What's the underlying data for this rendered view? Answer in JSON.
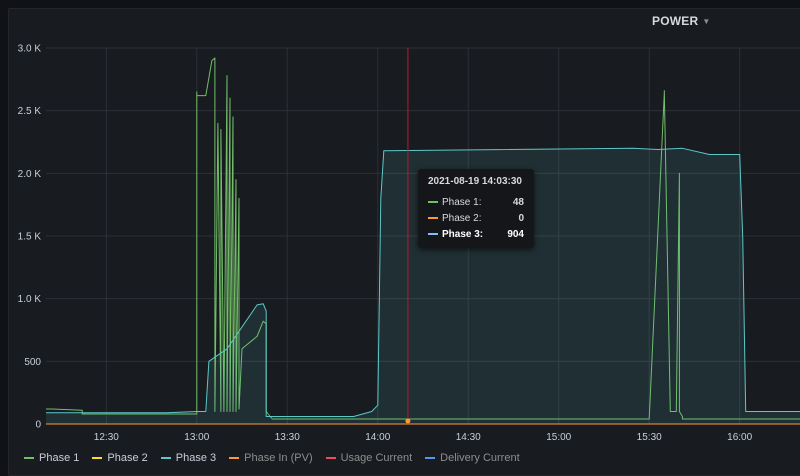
{
  "panel": {
    "title": "POWER"
  },
  "tooltip": {
    "time": "2021-08-19 14:03:30",
    "rows": [
      {
        "name": "Phase 1:",
        "value": "48",
        "color": "#73bf69"
      },
      {
        "name": "Phase 2:",
        "value": "0",
        "color": "#ff9830"
      },
      {
        "name": "Phase 3:",
        "value": "904",
        "color": "#8ab8ff"
      }
    ]
  },
  "legend": [
    {
      "name": "Phase 1",
      "color": "#73bf69"
    },
    {
      "name": "Phase 2",
      "color": "#fade2a"
    },
    {
      "name": "Phase 3",
      "color": "#5cc8c8"
    },
    {
      "name": "Phase In (PV)",
      "color": "#ff9830"
    },
    {
      "name": "Usage Current",
      "color": "#f2495c"
    },
    {
      "name": "Delivery Current",
      "color": "#5794f2"
    }
  ],
  "chart_data": {
    "type": "line",
    "x_range": [
      "12:10",
      "16:20"
    ],
    "x_ticks": [
      "12:30",
      "13:00",
      "13:30",
      "14:00",
      "14:30",
      "15:00",
      "15:30",
      "16:00"
    ],
    "y_range": [
      0,
      3000
    ],
    "y_ticks": [
      "0",
      "500",
      "1.0 K",
      "1.5 K",
      "2.0 K",
      "2.5 K",
      "3.0 K"
    ],
    "y_tick_values": [
      0,
      500,
      1000,
      1500,
      2000,
      2500,
      3000
    ],
    "crosshair_time": "14:10",
    "grid": true,
    "legend_position": "bottom-left",
    "series": [
      {
        "name": "Phase 1",
        "color": "#73bf69",
        "x": [
          "12:10",
          "12:12",
          "12:22",
          "12:22",
          "12:50",
          "13:00",
          "13:00",
          "13:00",
          "13:03",
          "13:05",
          "13:06",
          "13:06",
          "13:07",
          "13:08",
          "13:08",
          "13:09",
          "13:10",
          "13:10",
          "13:11",
          "13:11",
          "13:12",
          "13:12",
          "13:13",
          "13:13",
          "13:14",
          "13:14",
          "13:15",
          "13:20",
          "13:22",
          "13:23",
          "13:23",
          "13:25",
          "14:00",
          "15:00",
          "15:30",
          "15:35",
          "15:35",
          "15:37",
          "15:39",
          "15:40",
          "15:40",
          "15:40",
          "15:41",
          "15:41",
          "16:20"
        ],
        "y": [
          120,
          120,
          110,
          80,
          80,
          80,
          2650,
          2620,
          2620,
          2900,
          2920,
          100,
          2400,
          100,
          2350,
          100,
          2780,
          100,
          2600,
          100,
          2450,
          100,
          1950,
          100,
          1800,
          120,
          600,
          700,
          820,
          800,
          100,
          40,
          40,
          40,
          40,
          2640,
          2660,
          100,
          100,
          2000,
          100,
          100,
          60,
          40,
          40
        ]
      },
      {
        "name": "Phase 2",
        "color": "#fade2a",
        "x": [
          "12:10",
          "16:20"
        ],
        "y": [
          0,
          0
        ]
      },
      {
        "name": "Phase 3",
        "color": "#5cc8c8",
        "fill": true,
        "x": [
          "12:10",
          "12:50",
          "13:00",
          "13:03",
          "13:04",
          "13:10",
          "13:20",
          "13:22",
          "13:23",
          "13:23",
          "13:52",
          "13:58",
          "14:00",
          "14:01",
          "14:02",
          "15:25",
          "15:33",
          "15:41",
          "15:50",
          "16:00",
          "16:01",
          "16:02",
          "16:20"
        ],
        "y": [
          90,
          90,
          100,
          100,
          500,
          600,
          950,
          960,
          900,
          60,
          60,
          100,
          150,
          1800,
          2180,
          2200,
          2190,
          2200,
          2150,
          2150,
          1500,
          100,
          100
        ]
      },
      {
        "name": "Phase In (PV)",
        "color": "#ff9830",
        "x": [
          "12:10",
          "16:20"
        ],
        "y": [
          0,
          0
        ]
      }
    ]
  }
}
